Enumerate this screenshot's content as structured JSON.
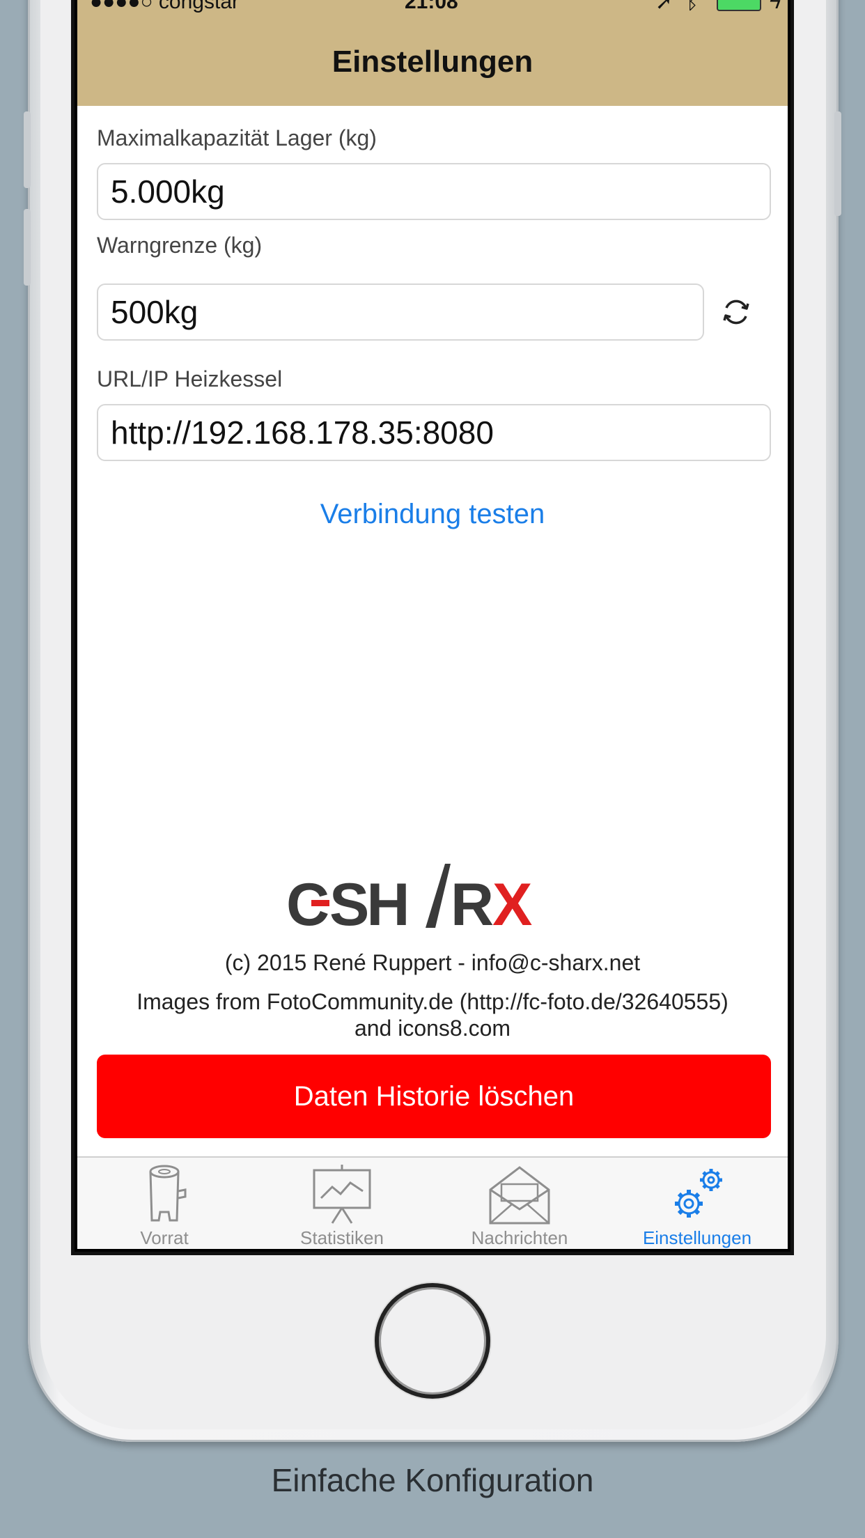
{
  "status_bar": {
    "carrier": "●●●●○ congstar",
    "time": "21:08"
  },
  "navbar": {
    "title": "Einstellungen"
  },
  "form": {
    "capacity": {
      "label": "Maximalkapazität Lager (kg)",
      "value": "5.000kg"
    },
    "warning": {
      "label": "Warngrenze (kg)",
      "value": "500kg"
    },
    "url": {
      "label": "URL/IP Heizkessel",
      "value": "http://192.168.178.35:8080"
    },
    "test_button": "Verbindung testen"
  },
  "logo": {
    "text": "C-SHARX"
  },
  "credits": {
    "copyright": "(c) 2015 René Ruppert - info@c-sharx.net",
    "images_line1": "Images from FotoCommunity.de (http://fc-foto.de/32640555)",
    "images_line2": "and icons8.com"
  },
  "delete_button": "Daten Historie löschen",
  "tabs": [
    {
      "label": "Vorrat",
      "icon": "wood-log-icon",
      "active": false
    },
    {
      "label": "Statistiken",
      "icon": "presentation-chart-icon",
      "active": false
    },
    {
      "label": "Nachrichten",
      "icon": "envelope-icon",
      "active": false
    },
    {
      "label": "Einstellungen",
      "icon": "gears-icon",
      "active": true
    }
  ],
  "colors": {
    "navbar": "#cdb786",
    "accent": "#1a7ee8",
    "danger": "#ff0000",
    "background": "#9aabb5"
  },
  "caption": "Einfache Konfiguration"
}
